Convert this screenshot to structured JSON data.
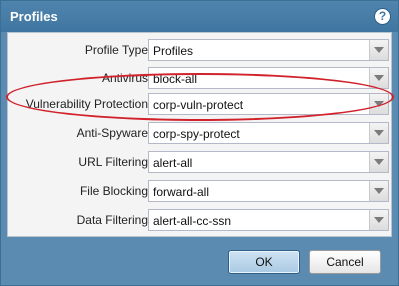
{
  "dialog": {
    "title": "Profiles",
    "help_icon": "help-icon",
    "help_glyph": "?"
  },
  "fields": [
    {
      "label": "Profile Type",
      "value": "Profiles"
    },
    {
      "label": "Antivirus",
      "value": "block-all"
    },
    {
      "label": "Vulnerability Protection",
      "value": "corp-vuln-protect"
    },
    {
      "label": "Anti-Spyware",
      "value": "corp-spy-protect"
    },
    {
      "label": "URL Filtering",
      "value": "alert-all"
    },
    {
      "label": "File Blocking",
      "value": "forward-all"
    },
    {
      "label": "Data Filtering",
      "value": "alert-all-cc-ssn"
    }
  ],
  "annotation": {
    "color": "#d1222c",
    "highlighted_field": "Vulnerability Protection"
  },
  "buttons": {
    "ok": "OK",
    "cancel": "Cancel"
  },
  "colors": {
    "titlebar": "#3f76a1",
    "panel": "#f4f4f4",
    "accent": "#5b8bb0"
  }
}
